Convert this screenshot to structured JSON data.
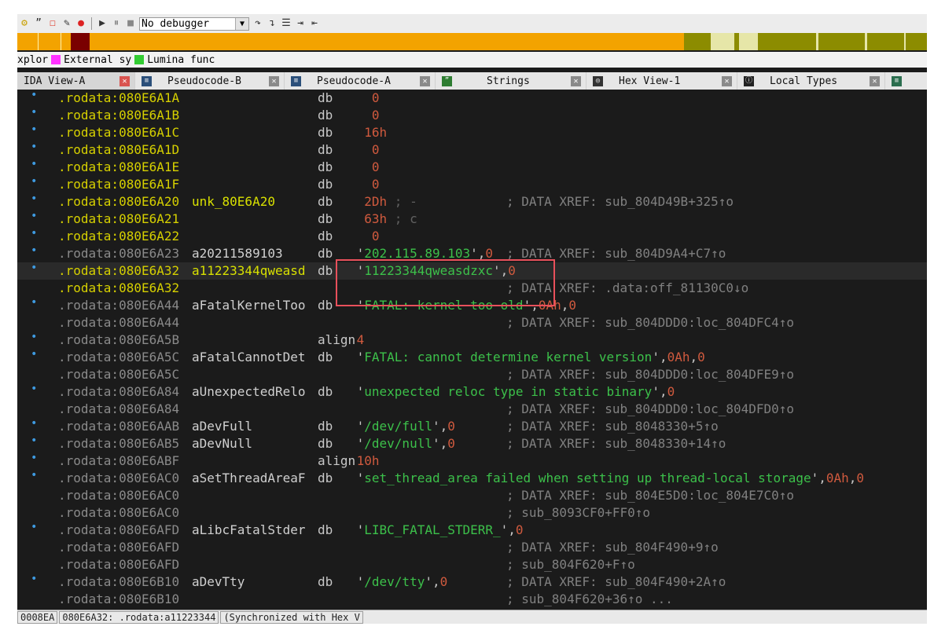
{
  "toolbar": {
    "debugger_label": "No debugger"
  },
  "legend": {
    "prefix": "xplor",
    "items": [
      {
        "label": "External sy",
        "color": "#ff33ff"
      },
      {
        "label": "Lumina func",
        "color": "#33cc33"
      }
    ]
  },
  "tabs": [
    {
      "label": "IDA View-A",
      "active": true
    },
    {
      "label": "Pseudocode-B",
      "active": false
    },
    {
      "label": "Pseudocode-A",
      "active": false
    },
    {
      "label": "Strings",
      "active": false
    },
    {
      "label": "Hex View-1",
      "active": false
    },
    {
      "label": "Local Types",
      "active": false
    }
  ],
  "listing": [
    {
      "bullet": true,
      "seg": ".rodata:",
      "addr": "080E6A1A",
      "label": "",
      "op": "db",
      "args": [
        {
          "t": "   0",
          "c": "num"
        }
      ],
      "comment": ""
    },
    {
      "bullet": true,
      "seg": ".rodata:",
      "addr": "080E6A1B",
      "label": "",
      "op": "db",
      "args": [
        {
          "t": "   0",
          "c": "num"
        }
      ],
      "comment": ""
    },
    {
      "bullet": true,
      "seg": ".rodata:",
      "addr": "080E6A1C",
      "label": "",
      "op": "db",
      "args": [
        {
          "t": "  16h",
          "c": "num"
        }
      ],
      "comment": ""
    },
    {
      "bullet": true,
      "seg": ".rodata:",
      "addr": "080E6A1D",
      "label": "",
      "op": "db",
      "args": [
        {
          "t": "   0",
          "c": "num"
        }
      ],
      "comment": ""
    },
    {
      "bullet": true,
      "seg": ".rodata:",
      "addr": "080E6A1E",
      "label": "",
      "op": "db",
      "args": [
        {
          "t": "   0",
          "c": "num"
        }
      ],
      "comment": ""
    },
    {
      "bullet": true,
      "seg": ".rodata:",
      "addr": "080E6A1F",
      "label": "",
      "op": "db",
      "args": [
        {
          "t": "   0",
          "c": "num"
        }
      ],
      "comment": ""
    },
    {
      "bullet": true,
      "seg": ".rodata:",
      "addr": "080E6A20",
      "label": "unk_80E6A20",
      "op": "db",
      "args": [
        {
          "t": "  2Dh",
          "c": "num"
        },
        {
          "t": " ; -",
          "c": "cmtg"
        }
      ],
      "comment": "; DATA XREF: sub_804D49B+325↑o"
    },
    {
      "bullet": true,
      "seg": ".rodata:",
      "addr": "080E6A21",
      "label": "",
      "op": "db",
      "args": [
        {
          "t": "  63h",
          "c": "num"
        },
        {
          "t": " ; c",
          "c": "cmtg"
        }
      ],
      "comment": ""
    },
    {
      "bullet": true,
      "seg": ".rodata:",
      "addr": "080E6A22",
      "label": "",
      "op": "db",
      "args": [
        {
          "t": "   0",
          "c": "num"
        }
      ],
      "comment": ""
    },
    {
      "bullet": true,
      "seg": ".rodata:",
      "addr": "080E6A23",
      "label": "a20211589103",
      "op": "db",
      "args": [
        {
          "t": " '",
          "c": "punc"
        },
        {
          "t": "202.115.89.103",
          "c": "str"
        },
        {
          "t": "',",
          "c": "punc"
        },
        {
          "t": "0",
          "c": "num"
        }
      ],
      "comment": "; DATA XREF: sub_804D9A4+C7↑o",
      "gray": true
    },
    {
      "bullet": true,
      "seg": ".rodata:",
      "addr": "080E6A32",
      "label": "a11223344qweasd",
      "op": "db",
      "args": [
        {
          "t": " '",
          "c": "punc"
        },
        {
          "t": "11223344qweasdzxc",
          "c": "str"
        },
        {
          "t": "',",
          "c": "punc"
        },
        {
          "t": "0",
          "c": "num"
        }
      ],
      "comment": "",
      "current": true
    },
    {
      "bullet": false,
      "seg": ".rodata:",
      "addr": "080E6A32",
      "label": "",
      "op": "",
      "args": [],
      "comment": "; DATA XREF: .data:off_81130C0↓o"
    },
    {
      "bullet": true,
      "seg": ".rodata:",
      "addr": "080E6A44",
      "label": "aFatalKernelToo",
      "op": "db",
      "args": [
        {
          "t": " '",
          "c": "punc"
        },
        {
          "t": "FATAL: kernel too old",
          "c": "str"
        },
        {
          "t": "',",
          "c": "punc"
        },
        {
          "t": "0Ah",
          "c": "num"
        },
        {
          "t": ",",
          "c": "punc"
        },
        {
          "t": "0",
          "c": "num"
        }
      ],
      "comment": "",
      "gray": true
    },
    {
      "bullet": false,
      "seg": ".rodata:",
      "addr": "080E6A44",
      "label": "",
      "op": "",
      "args": [],
      "comment": "; DATA XREF: sub_804DDD0:loc_804DFC4↑o",
      "gray": true
    },
    {
      "bullet": true,
      "seg": ".rodata:",
      "addr": "080E6A5B",
      "label": "",
      "op": "align",
      "args": [
        {
          "t": " 4",
          "c": "num"
        }
      ],
      "comment": "",
      "gray": true
    },
    {
      "bullet": true,
      "seg": ".rodata:",
      "addr": "080E6A5C",
      "label": "aFatalCannotDet",
      "op": "db",
      "args": [
        {
          "t": " '",
          "c": "punc"
        },
        {
          "t": "FATAL: cannot determine kernel version",
          "c": "str"
        },
        {
          "t": "',",
          "c": "punc"
        },
        {
          "t": "0Ah",
          "c": "num"
        },
        {
          "t": ",",
          "c": "punc"
        },
        {
          "t": "0",
          "c": "num"
        }
      ],
      "comment": "",
      "gray": true
    },
    {
      "bullet": false,
      "seg": ".rodata:",
      "addr": "080E6A5C",
      "label": "",
      "op": "",
      "args": [],
      "comment": "; DATA XREF: sub_804DDD0:loc_804DFE9↑o",
      "gray": true
    },
    {
      "bullet": true,
      "seg": ".rodata:",
      "addr": "080E6A84",
      "label": "aUnexpectedRelo",
      "op": "db",
      "args": [
        {
          "t": " '",
          "c": "punc"
        },
        {
          "t": "unexpected reloc type in static binary",
          "c": "str"
        },
        {
          "t": "',",
          "c": "punc"
        },
        {
          "t": "0",
          "c": "num"
        }
      ],
      "comment": "",
      "gray": true
    },
    {
      "bullet": false,
      "seg": ".rodata:",
      "addr": "080E6A84",
      "label": "",
      "op": "",
      "args": [],
      "comment": "; DATA XREF: sub_804DDD0:loc_804DFD0↑o",
      "gray": true
    },
    {
      "bullet": true,
      "seg": ".rodata:",
      "addr": "080E6AAB",
      "label": "aDevFull",
      "op": "db",
      "args": [
        {
          "t": " '",
          "c": "punc"
        },
        {
          "t": "/dev/full",
          "c": "str"
        },
        {
          "t": "',",
          "c": "punc"
        },
        {
          "t": "0",
          "c": "num"
        }
      ],
      "comment": "; DATA XREF: sub_8048330+5↑o",
      "gray": true
    },
    {
      "bullet": true,
      "seg": ".rodata:",
      "addr": "080E6AB5",
      "label": "aDevNull",
      "op": "db",
      "args": [
        {
          "t": " '",
          "c": "punc"
        },
        {
          "t": "/dev/null",
          "c": "str"
        },
        {
          "t": "',",
          "c": "punc"
        },
        {
          "t": "0",
          "c": "num"
        }
      ],
      "comment": "; DATA XREF: sub_8048330+14↑o",
      "gray": true
    },
    {
      "bullet": true,
      "seg": ".rodata:",
      "addr": "080E6ABF",
      "label": "",
      "op": "align",
      "args": [
        {
          "t": " 10h",
          "c": "num"
        }
      ],
      "comment": "",
      "gray": true
    },
    {
      "bullet": true,
      "seg": ".rodata:",
      "addr": "080E6AC0",
      "label": "aSetThreadAreaF",
      "op": "db",
      "args": [
        {
          "t": " '",
          "c": "punc"
        },
        {
          "t": "set_thread_area failed when setting up thread-local storage",
          "c": "str"
        },
        {
          "t": "',",
          "c": "punc"
        },
        {
          "t": "0Ah",
          "c": "num"
        },
        {
          "t": ",",
          "c": "punc"
        },
        {
          "t": "0",
          "c": "num"
        }
      ],
      "comment": "",
      "gray": true
    },
    {
      "bullet": false,
      "seg": ".rodata:",
      "addr": "080E6AC0",
      "label": "",
      "op": "",
      "args": [],
      "comment": "; DATA XREF: sub_804E5D0:loc_804E7C0↑o",
      "gray": true
    },
    {
      "bullet": false,
      "seg": ".rodata:",
      "addr": "080E6AC0",
      "label": "",
      "op": "",
      "args": [],
      "comment": "; sub_8093CF0+FF0↑o",
      "gray": true
    },
    {
      "bullet": true,
      "seg": ".rodata:",
      "addr": "080E6AFD",
      "label": "aLibcFatalStder",
      "op": "db",
      "args": [
        {
          "t": " '",
          "c": "punc"
        },
        {
          "t": "LIBC_FATAL_STDERR_",
          "c": "str"
        },
        {
          "t": "',",
          "c": "punc"
        },
        {
          "t": "0",
          "c": "num"
        }
      ],
      "comment": "",
      "gray": true
    },
    {
      "bullet": false,
      "seg": ".rodata:",
      "addr": "080E6AFD",
      "label": "",
      "op": "",
      "args": [],
      "comment": "; DATA XREF: sub_804F490+9↑o",
      "gray": true
    },
    {
      "bullet": false,
      "seg": ".rodata:",
      "addr": "080E6AFD",
      "label": "",
      "op": "",
      "args": [],
      "comment": "; sub_804F620+F↑o",
      "gray": true
    },
    {
      "bullet": true,
      "seg": ".rodata:",
      "addr": "080E6B10",
      "label": "aDevTty",
      "op": "db",
      "args": [
        {
          "t": " '",
          "c": "punc"
        },
        {
          "t": "/dev/tty",
          "c": "str"
        },
        {
          "t": "',",
          "c": "punc"
        },
        {
          "t": "0",
          "c": "num"
        }
      ],
      "comment": "; DATA XREF: sub_804F490+2A↑o",
      "gray": true
    },
    {
      "bullet": false,
      "seg": ".rodata:",
      "addr": "080E6B10",
      "label": "",
      "op": "",
      "args": [],
      "comment": "; sub_804F620+36↑o ...",
      "gray": true
    }
  ],
  "statusbar": {
    "offset": "0008EA",
    "location": "080E6A32: .rodata:a11223344",
    "sync": "(Synchronized with Hex V"
  },
  "colors": {
    "navband": "#f3a300",
    "highlight_box": "#e8505b"
  }
}
